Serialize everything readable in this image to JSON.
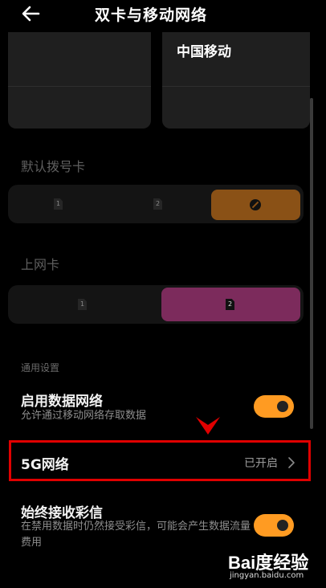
{
  "header": {
    "title": "双卡与移动网络"
  },
  "sim_cards": {
    "sim1_name": "",
    "sim2_name": "中国移动"
  },
  "default_dial": {
    "title": "默认拨号卡",
    "options": [
      "1",
      "2"
    ],
    "selected": "no-default"
  },
  "data_sim": {
    "title": "上网卡",
    "options": [
      "1",
      "2"
    ],
    "selected": "2"
  },
  "general": {
    "group_label": "通用设置",
    "enable_data": {
      "title": "启用数据网络",
      "description": "允许通过移动网络存取数据",
      "enabled": true
    },
    "network_5g": {
      "title": "5G网络",
      "value": "已开启"
    },
    "always_mms": {
      "title": "始终接收彩信",
      "description": "在禁用数据时仍然接受彩信，可能会产生数据流量费用",
      "enabled": true
    }
  },
  "annotation": {
    "highlight_color": "#e00000"
  },
  "watermark": {
    "logo": "Bai度经验",
    "url": "jingyan.baidu.com"
  },
  "colors": {
    "accent_orange": "#ff9b22",
    "selected_dial": "#8a5116",
    "selected_data": "#7c2b5c"
  }
}
